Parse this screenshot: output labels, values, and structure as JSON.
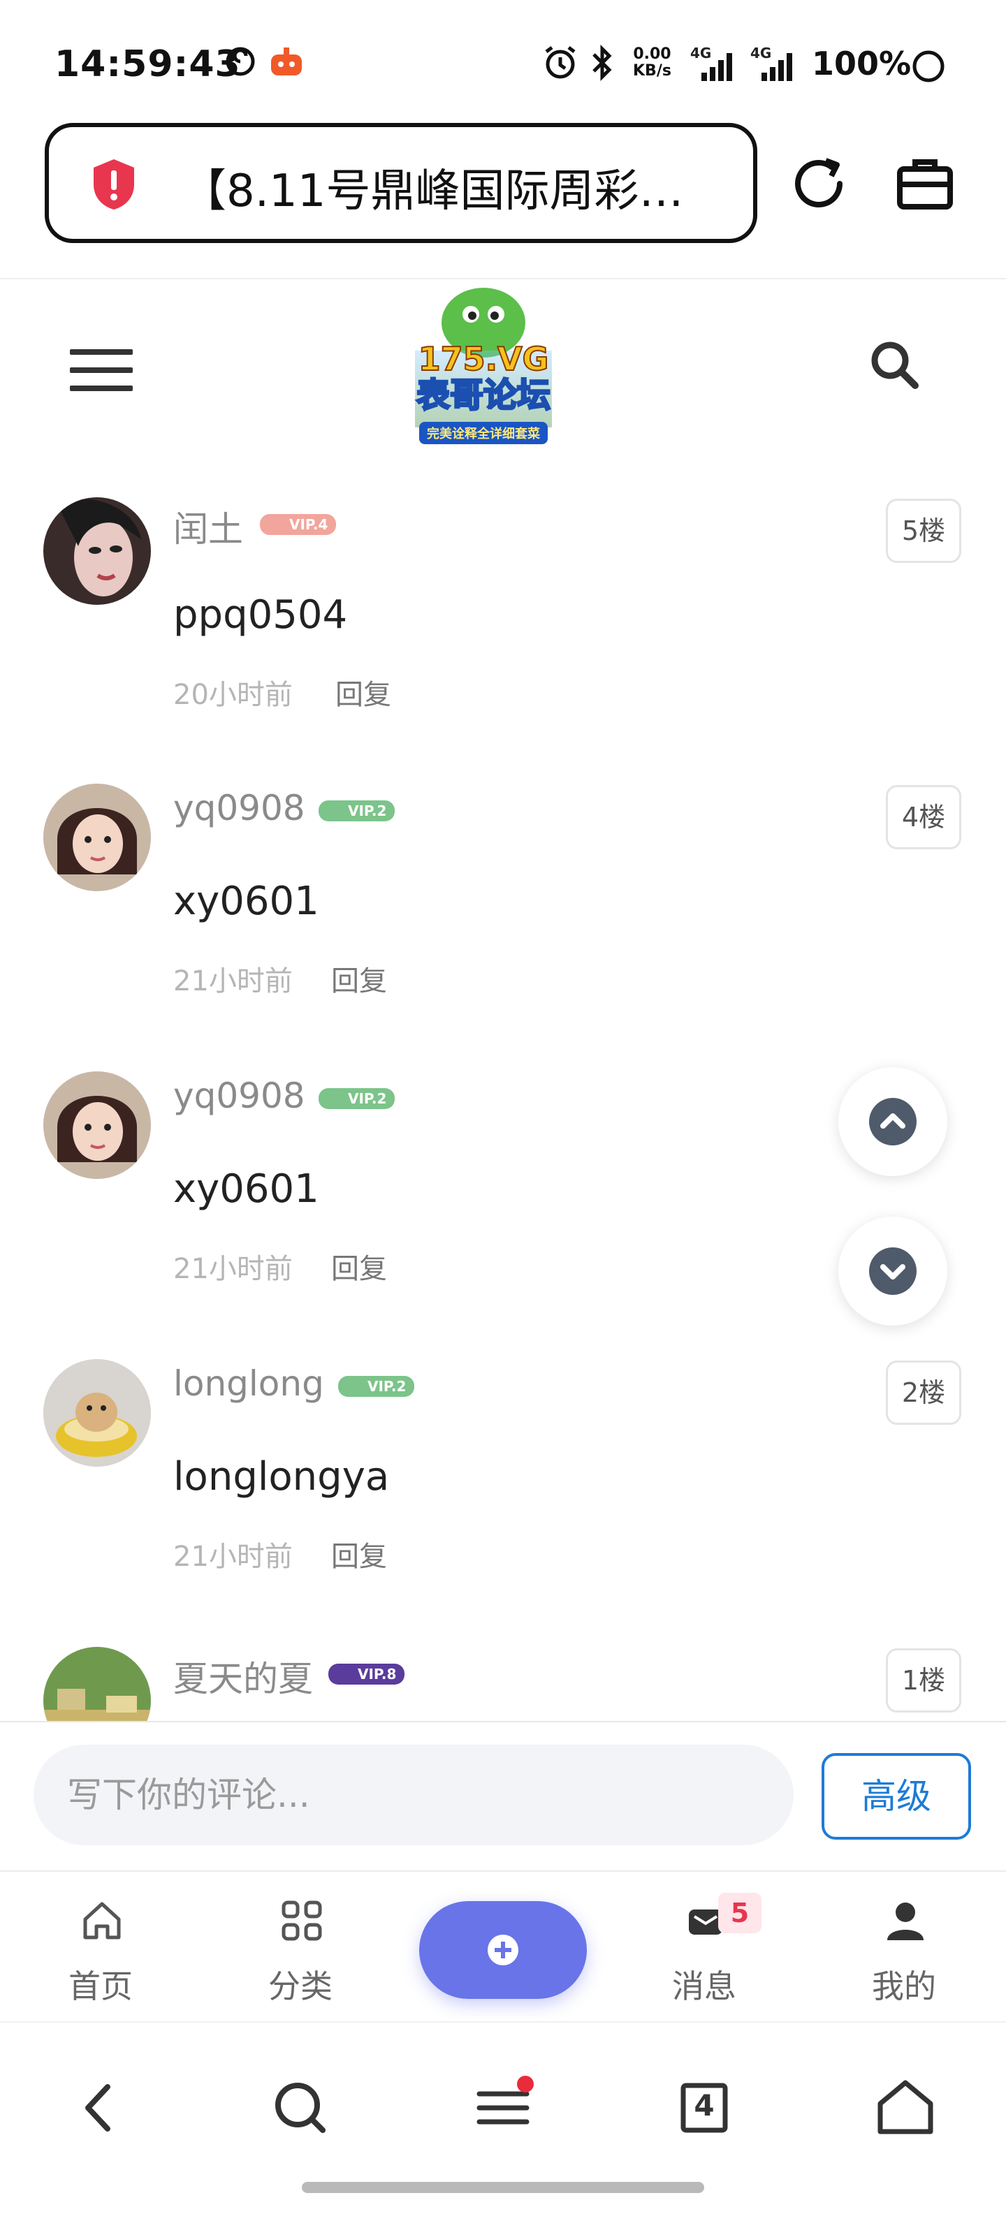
{
  "status_bar": {
    "time": "14:59:43",
    "net_speed_value": "0.00",
    "net_speed_unit": "KB/s",
    "sim1": "4G",
    "sim2": "4G",
    "battery": "100%"
  },
  "url_bar": {
    "title": "【8.11号鼎峰国际周彩…",
    "security_color": "#e8364f"
  },
  "site": {
    "logo_line1": "175.VG",
    "logo_line2": "表哥论坛",
    "logo_tagline": "完美诠释全详细套菜"
  },
  "comments": [
    {
      "username": "闰土",
      "vip": "VIP.4",
      "vip_color": "#e66b62",
      "floor": "5楼",
      "text": "ppq0504",
      "time": "20小时前",
      "reply": "回复",
      "avatar": "avatar-woman-illustration"
    },
    {
      "username": "yq0908",
      "vip": "VIP.2",
      "vip_color": "#5db36d",
      "floor": "4楼",
      "text": "xy0601",
      "time": "21小时前",
      "reply": "回复",
      "avatar": "avatar-girl-photo"
    },
    {
      "username": "yq0908",
      "vip": "VIP.2",
      "vip_color": "#5db36d",
      "floor": "",
      "text": "xy0601",
      "time": "21小时前",
      "reply": "回复",
      "avatar": "avatar-girl-photo"
    },
    {
      "username": "longlong",
      "vip": "VIP.2",
      "vip_color": "#5db36d",
      "floor": "2楼",
      "text": "longlongya",
      "time": "21小时前",
      "reply": "回复",
      "avatar": "avatar-hamster-photo"
    },
    {
      "username": "夏天的夏",
      "vip": "VIP.8",
      "vip_color": "#5a3c9c",
      "floor": "1楼",
      "text": "",
      "time": "",
      "reply": "",
      "avatar": "avatar-landscape-photo"
    }
  ],
  "compose": {
    "placeholder": "写下你的评论...",
    "advanced_label": "高级"
  },
  "bottom_nav": {
    "home": "首页",
    "category": "分类",
    "messages": "消息",
    "messages_badge": "5",
    "mine": "我的",
    "accent_color": "#6874e8"
  },
  "browser_bar": {
    "tab_count": "4"
  }
}
